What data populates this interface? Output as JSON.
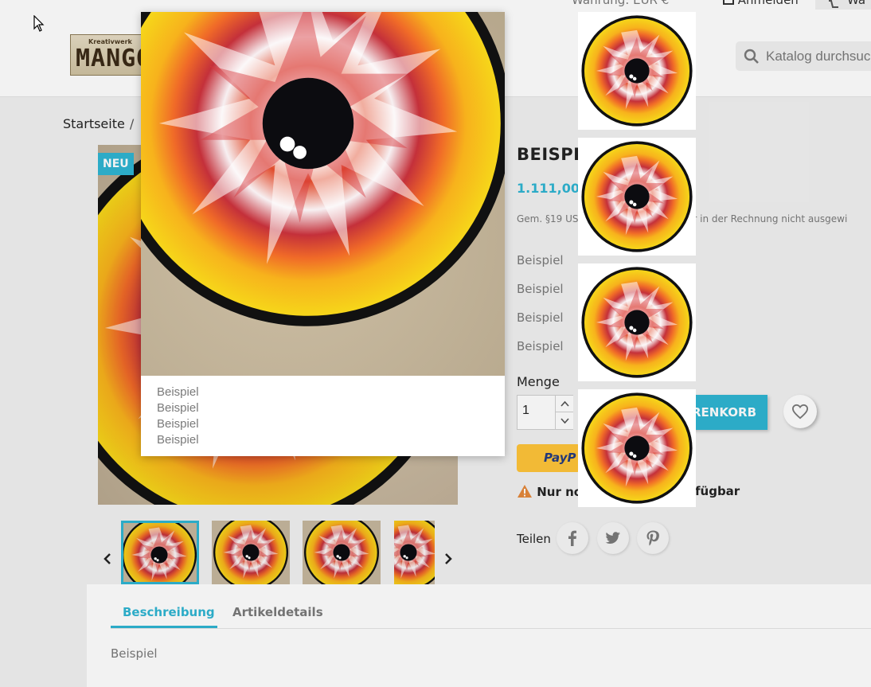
{
  "header": {
    "currency_label": "Währung: EUR €",
    "login_label": "Anmelden",
    "cart_label": "Wa",
    "logo_small": "Kreativwerk",
    "logo_big": "MANGO",
    "search_placeholder": "Katalog durchsuchen"
  },
  "breadcrumb": {
    "home": "Startseite",
    "separator": "/"
  },
  "product": {
    "badge": "NEU",
    "title": "BEISPIEL",
    "price": "1.111,00 €",
    "tax_note_left": "Gem. §19 US",
    "tax_note_right": "euer in der Rechnung nicht ausgewi",
    "attributes": [
      "Beispiel",
      "Beispiel",
      "Beispiel",
      "Beispiel"
    ],
    "quantity_label": "Menge",
    "quantity_value": "1",
    "add_to_cart_label": "RENKORB",
    "paypal_label": "PayP",
    "stock_left": "Nur no",
    "stock_right": "fügbar",
    "share_label": "Teilen"
  },
  "tabs": [
    {
      "label": "Beschreibung",
      "active": true
    },
    {
      "label": "Artikeldetails",
      "active": false
    }
  ],
  "tab_content": "Beispiel",
  "popup": {
    "lines": [
      "Beispiel",
      "Beispiel",
      "Beispiel",
      "Beispiel"
    ]
  },
  "colors": {
    "accent": "#2fb5d2",
    "paypal_yellow": "#ffc439",
    "paypal_blue": "#253b80",
    "warning": "#e4883b"
  },
  "icons": [
    "search-icon",
    "heart-icon",
    "facebook-icon",
    "twitter-icon",
    "pinterest-icon",
    "warning-icon",
    "chevron-left-icon",
    "chevron-right-icon",
    "user-icon",
    "cart-icon"
  ]
}
